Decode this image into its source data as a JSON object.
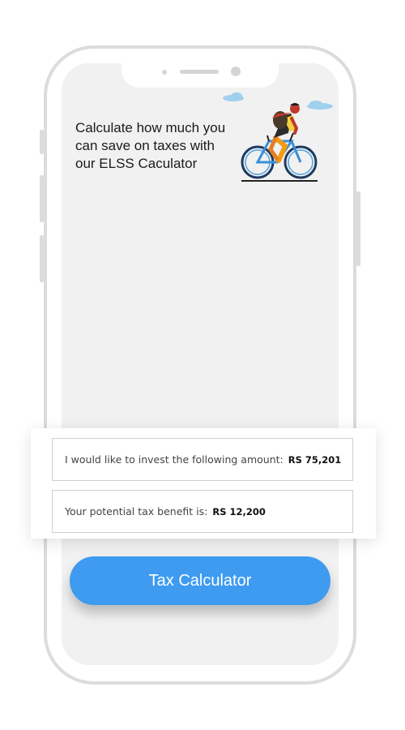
{
  "headline": {
    "line1": "Calculate how much you",
    "line2": "can save on taxes with",
    "line3": "our ELSS Caculator"
  },
  "illustration": {
    "icon": "cyclist-illustration",
    "accent": "#f39c12"
  },
  "calculator": {
    "invest_label": "I would like to invest the following amount:",
    "invest_value": "RS 75,201",
    "benefit_label": "Your potential tax benefit is:",
    "benefit_value": "RS 12,200"
  },
  "button": {
    "label": "Tax Calculator",
    "color": "#3f9bf0"
  }
}
